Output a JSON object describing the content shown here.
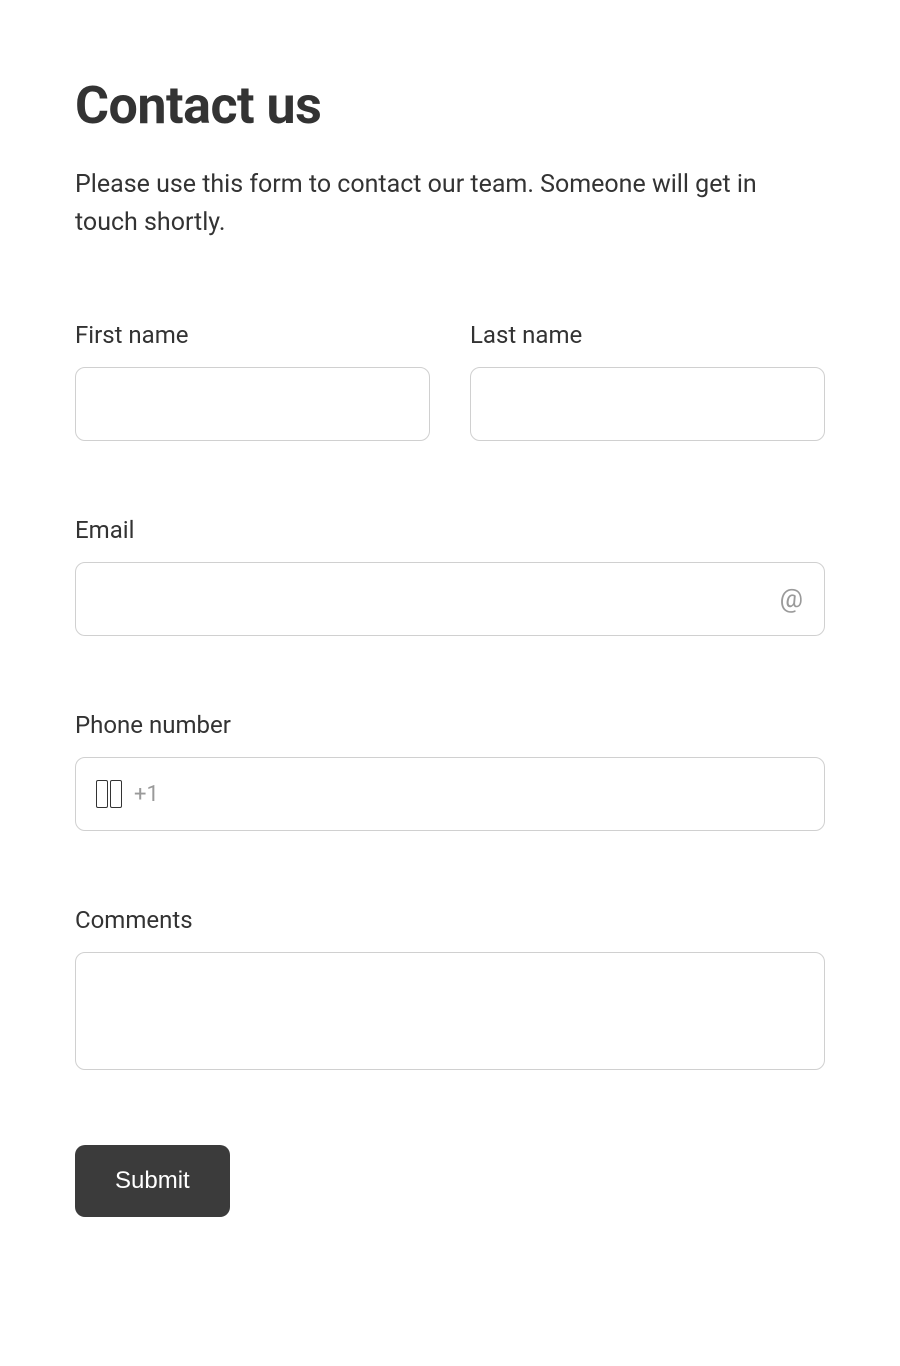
{
  "title": "Contact us",
  "description": "Please use this form to contact our team. Someone will get in touch shortly.",
  "fields": {
    "firstName": {
      "label": "First name",
      "value": ""
    },
    "lastName": {
      "label": "Last name",
      "value": ""
    },
    "email": {
      "label": "Email",
      "value": ""
    },
    "phone": {
      "label": "Phone number",
      "prefix": "+1",
      "value": ""
    },
    "comments": {
      "label": "Comments",
      "value": ""
    }
  },
  "submitLabel": "Submit"
}
